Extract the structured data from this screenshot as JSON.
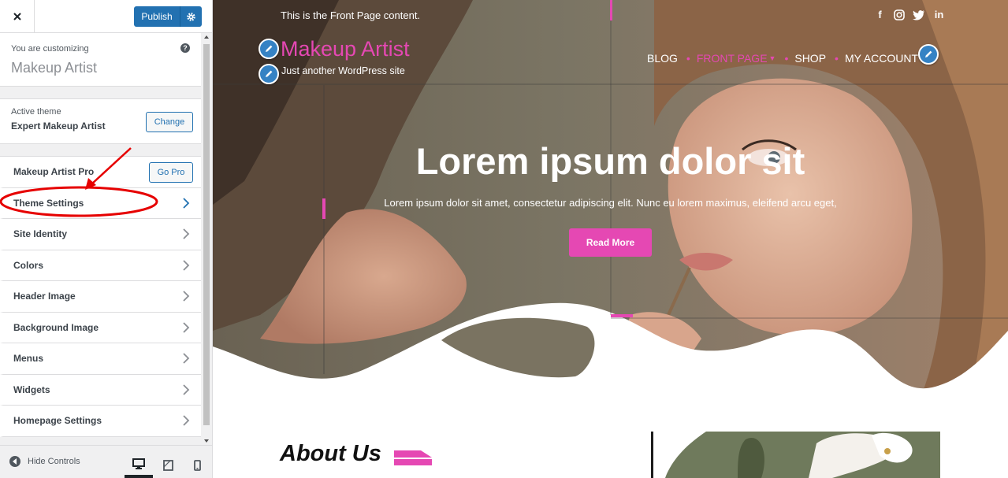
{
  "customizer": {
    "publish_label": "Publish",
    "customizing_label": "You are customizing",
    "site_name": "Makeup Artist",
    "active_theme_label": "Active theme",
    "active_theme_name": "Expert Makeup Artist",
    "change_label": "Change",
    "go_pro_label": "Go Pro",
    "sections": [
      {
        "label": "Makeup Artist Pro"
      },
      {
        "label": "Theme Settings"
      },
      {
        "label": "Site Identity"
      },
      {
        "label": "Colors"
      },
      {
        "label": "Header Image"
      },
      {
        "label": "Background Image"
      },
      {
        "label": "Menus"
      },
      {
        "label": "Widgets"
      },
      {
        "label": "Homepage Settings"
      }
    ],
    "hide_controls_label": "Hide Controls",
    "devices": [
      "desktop-icon",
      "tablet-icon",
      "mobile-icon"
    ]
  },
  "preview": {
    "topbar_text": "This is the Front Page content.",
    "social": [
      "f",
      "instagram-icon",
      "twitter-icon",
      "in"
    ],
    "site_title": "Makeup Artist",
    "tagline": "Just another WordPress site",
    "nav": [
      "BLOG",
      "FRONT PAGE",
      "SHOP",
      "MY ACCOUNT"
    ],
    "hero_title": "Lorem ipsum dolor sit",
    "hero_text": "Lorem ipsum dolor sit amet, consectetur adipiscing elit. Nunc eu lorem maximus, eleifend arcu eget,",
    "read_more": "Read More",
    "about_title": "About Us"
  },
  "colors": {
    "accent_pink": "#e548b3",
    "wp_blue": "#2271b1",
    "annotation_red": "#e60000"
  }
}
